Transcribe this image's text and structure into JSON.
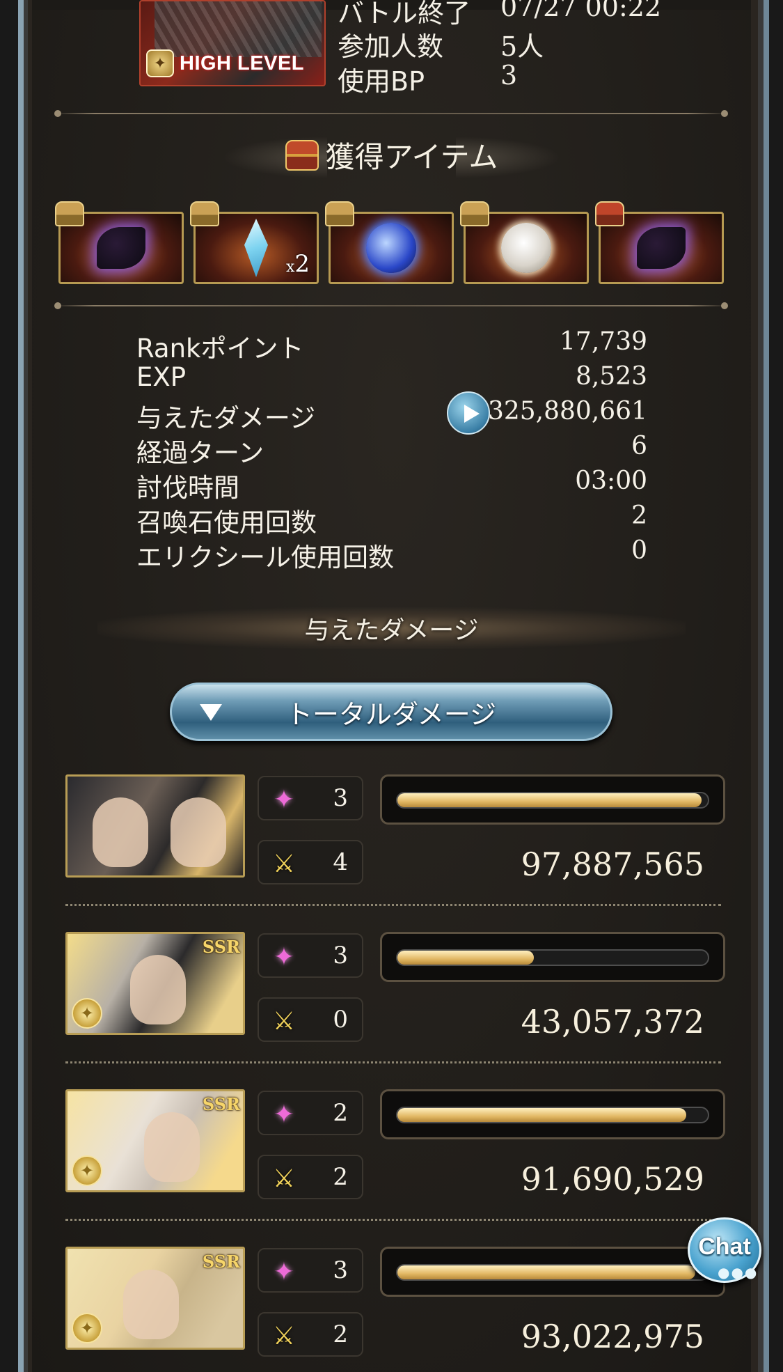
{
  "quest": {
    "badge": "HIGH LEVEL",
    "info": [
      {
        "label": "バトル終了",
        "value": "07/27 00:22"
      },
      {
        "label": "参加人数",
        "value": "5人"
      },
      {
        "label": "使用BP",
        "value": "3"
      }
    ]
  },
  "items_section": {
    "title": "獲得アイテム",
    "items": [
      {
        "icon": "dark-claw-icon",
        "count": "",
        "chest": "gold"
      },
      {
        "icon": "crystal-icon",
        "count": "x2",
        "chest": "gold"
      },
      {
        "icon": "blue-orb-icon",
        "count": "",
        "chest": "gold"
      },
      {
        "icon": "silver-orb-icon",
        "count": "",
        "chest": "gold"
      },
      {
        "icon": "dark-claw-icon",
        "count": "",
        "chest": "red"
      }
    ]
  },
  "stats": [
    {
      "label": "Rankポイント",
      "value": "17,739"
    },
    {
      "label": "EXP",
      "value": "8,523"
    },
    {
      "label": "与えたダメージ",
      "value": "325,880,661"
    },
    {
      "label": "経過ターン",
      "value": "6"
    },
    {
      "label": "討伐時間",
      "value": "03:00"
    },
    {
      "label": "召喚石使用回数",
      "value": "2"
    },
    {
      "label": "エリクシール使用回数",
      "value": "0"
    }
  ],
  "damage_section": {
    "heading": "与えたダメージ",
    "dropdown_label": "トータルダメージ"
  },
  "players": [
    {
      "ssr": "",
      "skill_count": "3",
      "attack_count": "4",
      "damage": "97,887,565",
      "bar_fraction": 0.98
    },
    {
      "ssr": "SSR",
      "skill_count": "3",
      "attack_count": "0",
      "damage": "43,057,372",
      "bar_fraction": 0.44
    },
    {
      "ssr": "SSR",
      "skill_count": "2",
      "attack_count": "2",
      "damage": "91,690,529",
      "bar_fraction": 0.93
    },
    {
      "ssr": "SSR",
      "skill_count": "3",
      "attack_count": "2",
      "damage": "93,022,975",
      "bar_fraction": 0.96
    }
  ],
  "chat": {
    "label": "Chat"
  },
  "colors": {
    "bar_gold": "#e2b864",
    "panel": "#211e1a",
    "accent_blue": "#4aa3cf"
  }
}
